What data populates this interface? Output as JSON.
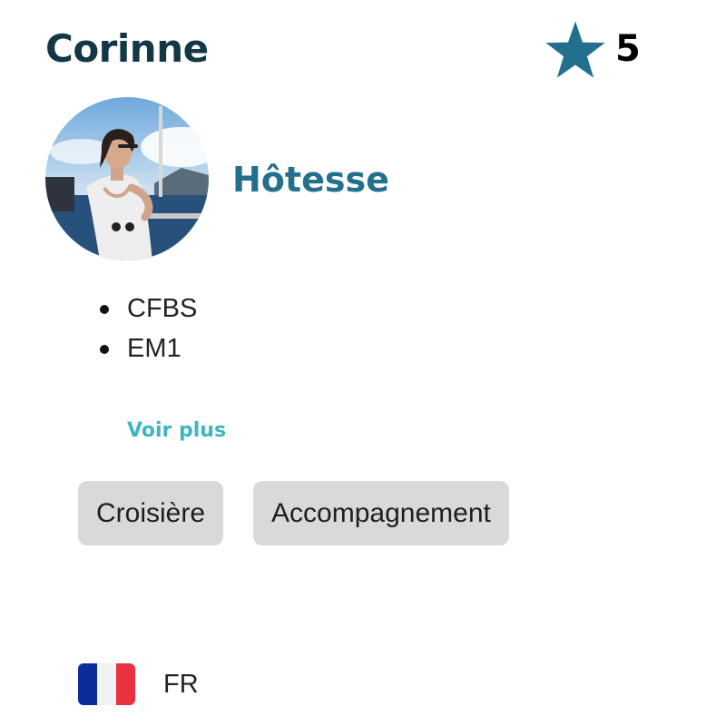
{
  "profile": {
    "name": "Corinne",
    "rating": "5",
    "role": "Hôtesse",
    "certifications": [
      "CFBS",
      "EM1"
    ],
    "see_more_label": "Voir plus",
    "tags": [
      "Croisière",
      "Accompagnement"
    ],
    "language": {
      "code": "FR",
      "flag_icon": "france-flag-icon"
    }
  },
  "icons": {
    "rating": "star-icon"
  },
  "colors": {
    "name_text": "#123846",
    "star": "#23708e",
    "role_text": "#23708e",
    "link": "#3bb7bf",
    "tag_background": "#d9d9d9"
  }
}
